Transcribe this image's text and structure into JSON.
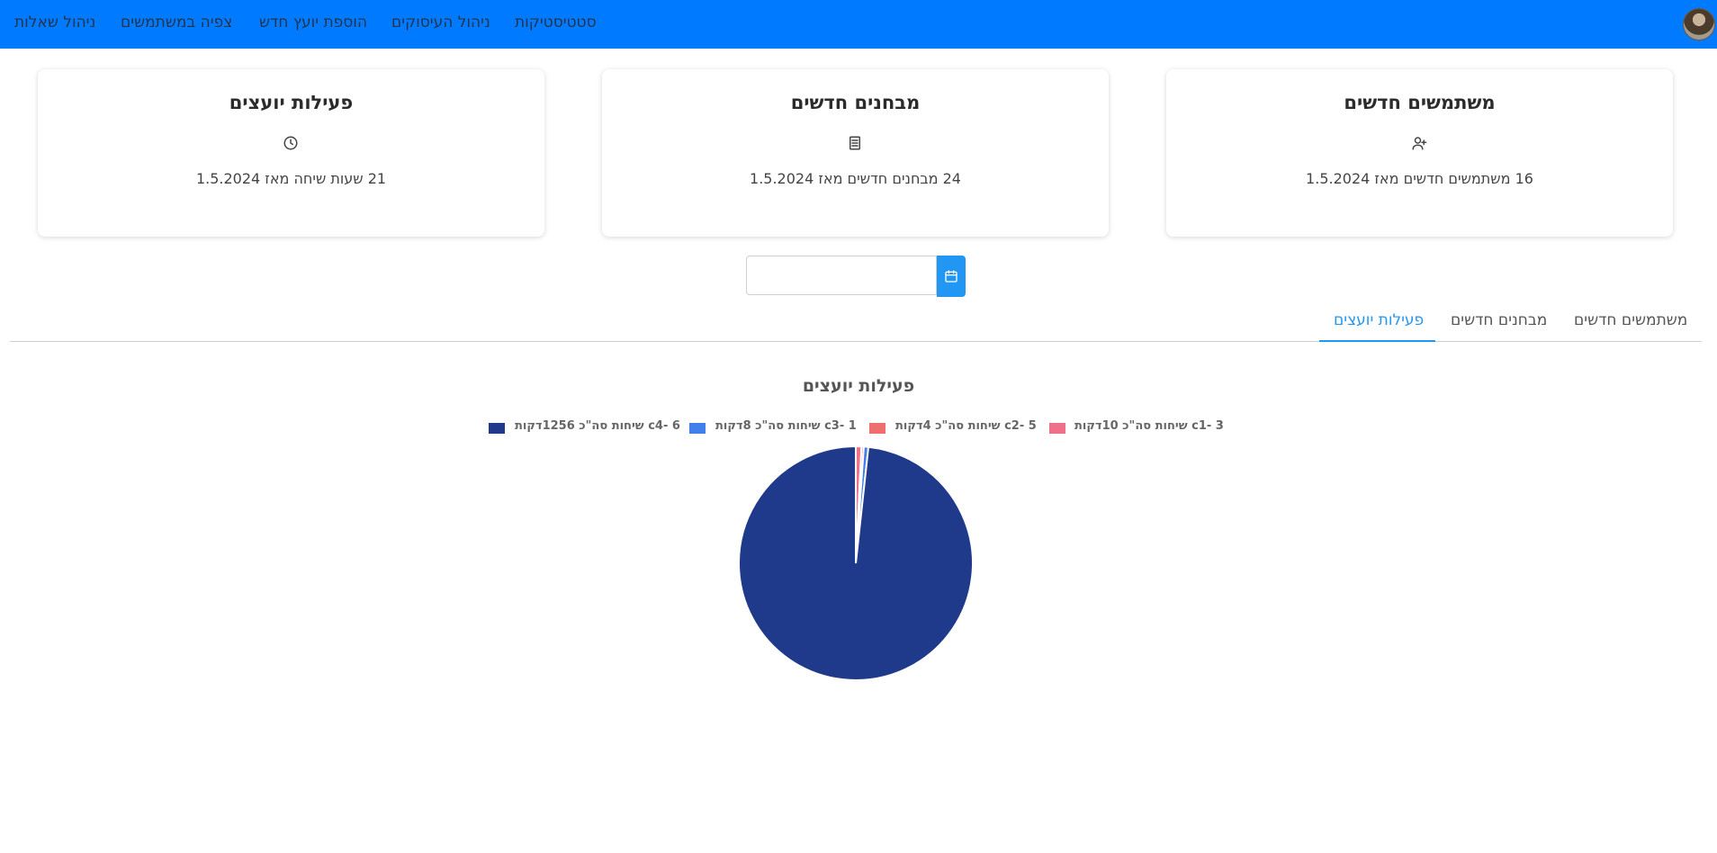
{
  "nav": {
    "items": [
      {
        "label": "ניהול שאלות"
      },
      {
        "label": "צפיה במשתמשים"
      },
      {
        "label": "הוספת יועץ חדש"
      },
      {
        "label": "ניהול העיסוקים"
      },
      {
        "label": "סטטיסטיקות"
      }
    ]
  },
  "cards": [
    {
      "title": "פעילות יועצים",
      "icon": "clock-icon",
      "text": "21 שעות שיחה מאז 1.5.2024"
    },
    {
      "title": "מבחנים חדשים",
      "icon": "document-icon",
      "text": "24 מבחנים חדשים מאז 1.5.2024"
    },
    {
      "title": "משתמשים חדשים",
      "icon": "user-plus-icon",
      "text": "16 משתמשים חדשים מאז 1.5.2024"
    }
  ],
  "date_picker": {
    "value": "",
    "icon": "calendar-icon"
  },
  "tabs": [
    {
      "label": "פעילות יועצים",
      "active": true
    },
    {
      "label": "מבחנים חדשים",
      "active": false
    },
    {
      "label": "משתמשים חדשים",
      "active": false
    }
  ],
  "colors": {
    "navbar": "#007bff",
    "accent": "#2196f3"
  },
  "chart_data": {
    "type": "pie",
    "title": "פעילות יועצים",
    "legend_position": "top",
    "slices": [
      {
        "label": "c1- 3 שיחות סה\"כ 10דקות",
        "value": 10,
        "color": "#f07089"
      },
      {
        "label": "c2- 5 שיחות סה\"כ 4דקות",
        "value": 4,
        "color": "#ef6f6f"
      },
      {
        "label": "c3- 1 שיחות סה\"כ 8דקות",
        "value": 8,
        "color": "#3f80ea"
      },
      {
        "label": "c4- 6 שיחות סה\"כ 1256דקות",
        "value": 1256,
        "color": "#1f3a8a"
      }
    ]
  }
}
